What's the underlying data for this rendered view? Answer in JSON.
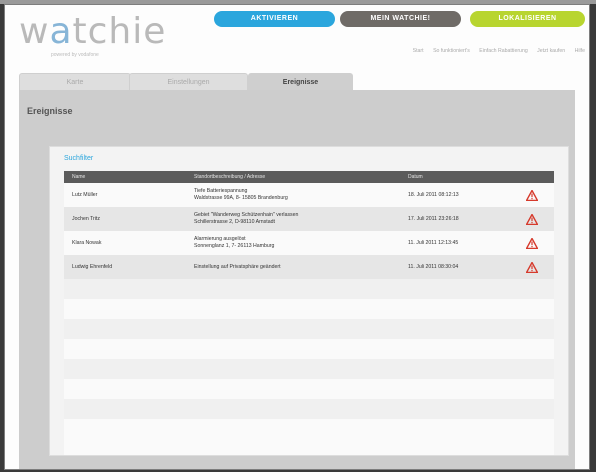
{
  "brand": {
    "logo_text_pre": "w",
    "logo_text_dot": "a",
    "logo_text_post": "tchie",
    "tagline": "powered by vodafone"
  },
  "nav_pills": {
    "activate": "AKTIVIEREN",
    "my_watchie": "MEIN WATCHIE!",
    "locate": "LOKALISIEREN"
  },
  "top_links": [
    "Start",
    "So funktioniert's",
    "Einfach Rabattierung",
    "Jetzt kaufen",
    "Hilfe"
  ],
  "tabs": {
    "map": "Karte",
    "settings": "Einstellungen",
    "events": "Ereignisse"
  },
  "panel": {
    "title": "Ereignisse",
    "subtitle": "Suchfilter"
  },
  "table": {
    "columns": {
      "name": "Name",
      "description": "Standortbeschreibung / Adresse",
      "date": "Datum"
    },
    "rows": [
      {
        "name": "Lutz Müller",
        "desc_line1": "Tiefe Batteriespannung",
        "desc_line2": "Waldstrasse 99A, 8- 15805 Brandenburg",
        "date": "18. Juli 2011 08:12:13"
      },
      {
        "name": "Jochen Tritz",
        "desc_line1": "Gebiet \"Wanderweg Schützenhain\" verlassen",
        "desc_line2": "Schillerstrasse 2, D-98110 Arnstadt",
        "date": "17. Juli 2011 23:26:18"
      },
      {
        "name": "Klara Nowak",
        "desc_line1": "Alarmierung ausgelöst",
        "desc_line2": "Sonnenglanz 1, 7- 26113 Hamburg",
        "date": "11. Juli 2011 12:13:45"
      },
      {
        "name": "Ludwig Ehrenfeld",
        "desc_line1": "Einstellung auf Privatsphäre geändert",
        "desc_line2": "",
        "date": "11. Juli 2011 08:30:04"
      }
    ]
  },
  "colors": {
    "accent_blue": "#2ba6dd",
    "accent_gray": "#6f6b67",
    "accent_green": "#b8d52f",
    "warning_red": "#d63a2c"
  }
}
